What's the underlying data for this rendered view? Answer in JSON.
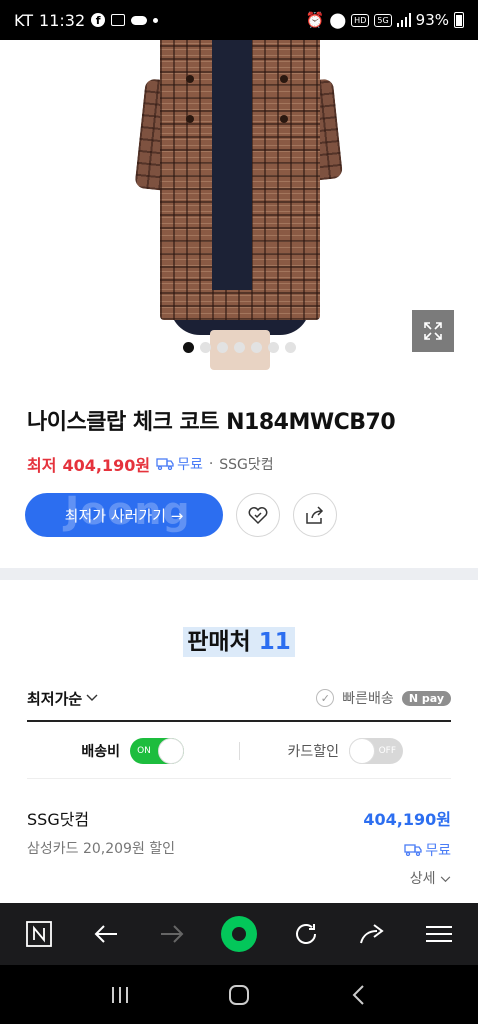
{
  "status_bar": {
    "carrier": "KT",
    "time": "11:32",
    "battery": "93%",
    "icons": [
      "facebook-icon",
      "calendar-icon",
      "cloud-icon",
      "dot-icon",
      "alarm-icon",
      "location-icon",
      "hd-icon",
      "5g-icon",
      "signal-icon",
      "battery-icon"
    ]
  },
  "gallery": {
    "image_count": 7,
    "active_index": 0,
    "expand_icon": "expand-icon"
  },
  "product": {
    "title": "나이스클랍 체크 코트 N184MWCB70",
    "lowest_label": "최저",
    "lowest_price": "404,190원",
    "shipping": "무료",
    "separator": "·",
    "seller": "SSG닷컴"
  },
  "actions": {
    "buy_label": "최저가 사러가기 →",
    "watermark": "Joong",
    "wishlist_icon": "heart-check-icon",
    "share_icon": "share-icon"
  },
  "sellers": {
    "title": "판매처",
    "count": "11",
    "sort_label": "최저가순",
    "fast_delivery": "빠른배송",
    "npay": "N pay",
    "shipping_filter": "배송비",
    "shipping_toggle": "ON",
    "card_filter": "카드할인",
    "card_toggle": "OFF"
  },
  "seller_rows": [
    {
      "name": "SSG닷컴",
      "price": "404,190원",
      "discount": "삼성카드 20,209원 할인",
      "shipping": "무료",
      "detail": "상세"
    }
  ],
  "browser_toolbar": {
    "items": [
      "naver-home-icon",
      "back-arrow-icon",
      "forward-arrow-icon",
      "green-dot-icon",
      "refresh-icon",
      "share-arrow-icon",
      "menu-icon"
    ]
  },
  "nav_bar": {
    "items": [
      "recent-apps-icon",
      "home-icon",
      "back-icon"
    ]
  },
  "colors": {
    "accent_blue": "#2c6ef0",
    "price_red": "#e5323c",
    "toggle_green": "#1dbd3e",
    "browser_green": "#03c75a"
  }
}
